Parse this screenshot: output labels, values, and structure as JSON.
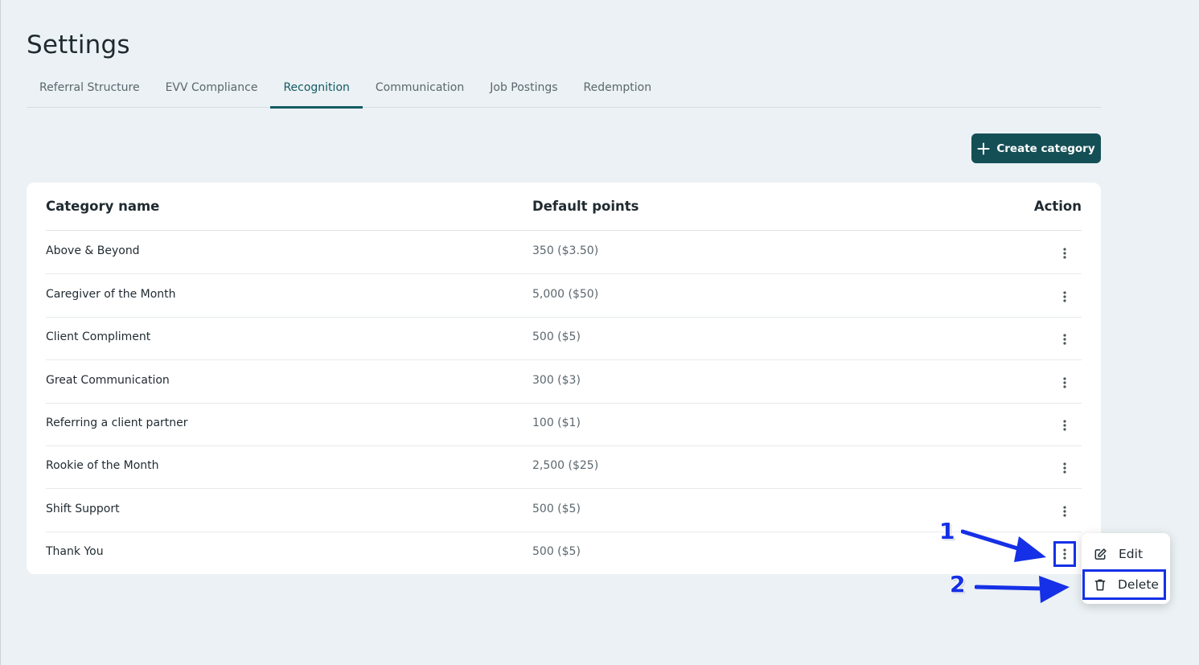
{
  "page": {
    "title": "Settings"
  },
  "tabs": [
    {
      "label": "Referral Structure",
      "active": false
    },
    {
      "label": "EVV Compliance",
      "active": false
    },
    {
      "label": "Recognition",
      "active": true
    },
    {
      "label": "Communication",
      "active": false
    },
    {
      "label": "Job Postings",
      "active": false
    },
    {
      "label": "Redemption",
      "active": false
    }
  ],
  "toolbar": {
    "create_label": "Create category",
    "create_icon": "plus-icon"
  },
  "table": {
    "headers": {
      "name": "Category name",
      "points": "Default points",
      "action": "Action"
    },
    "rows": [
      {
        "name": "Above & Beyond",
        "points": "350 ($3.50)"
      },
      {
        "name": "Caregiver of the Month",
        "points": "5,000 ($50)"
      },
      {
        "name": "Client Compliment",
        "points": "500 ($5)"
      },
      {
        "name": "Great Communication",
        "points": "300 ($3)"
      },
      {
        "name": "Referring a client partner",
        "points": "100 ($1)"
      },
      {
        "name": "Rookie of the Month",
        "points": "2,500 ($25)"
      },
      {
        "name": "Shift Support",
        "points": "500 ($5)"
      },
      {
        "name": "Thank You",
        "points": "500 ($5)"
      }
    ]
  },
  "context_menu": {
    "items": [
      {
        "label": "Edit",
        "icon": "edit-icon"
      },
      {
        "label": "Delete",
        "icon": "trash-icon"
      }
    ]
  },
  "annotations": {
    "step1": "1",
    "step2": "2"
  },
  "colors": {
    "accent": "#135b63",
    "button": "#154f56",
    "highlight": "#1530e6",
    "background": "#ebf1f4"
  }
}
